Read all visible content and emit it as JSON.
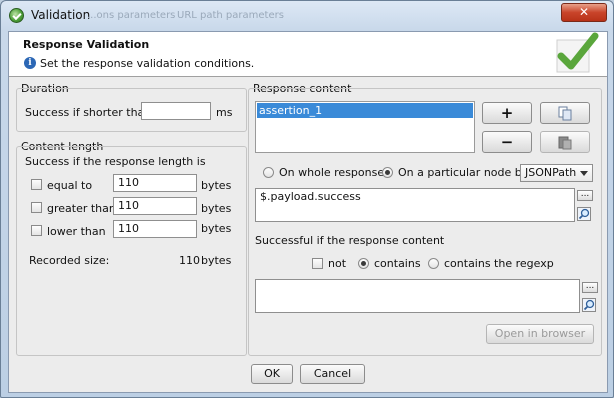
{
  "window": {
    "title": "Validation",
    "ghost_tab_1": "...ons parameters",
    "ghost_tab_2": "URL path parameters",
    "close_glyph": "✕"
  },
  "header": {
    "title": "Response Validation",
    "subtitle": "Set the response validation conditions."
  },
  "duration": {
    "label": "Duration",
    "shorter_label": "Success if shorter than",
    "value": "",
    "unit": "ms"
  },
  "content_length": {
    "label": "Content length",
    "intro": "Success if the response length is",
    "rows": [
      {
        "label": "equal to",
        "value": "110",
        "unit": "bytes",
        "checked": false
      },
      {
        "label": "greater than",
        "value": "110",
        "unit": "bytes",
        "checked": false
      },
      {
        "label": "lower than",
        "value": "110",
        "unit": "bytes",
        "checked": false
      }
    ],
    "recorded_label": "Recorded size:",
    "recorded_value": "110",
    "recorded_unit": "bytes"
  },
  "response_content": {
    "label": "Response content",
    "assertions": [
      "assertion_1"
    ],
    "add_label": "+",
    "remove_label": "−",
    "scope_whole": "On whole response",
    "scope_node": "On a particular node by",
    "selector": "JSONPath",
    "path_value": "$.payload.success",
    "success_label": "Successful if the response content",
    "not_label": "not",
    "contains_label": "contains",
    "regex_label": "contains the regexp",
    "content_value": "",
    "open_browser_label": "Open in browser",
    "ellipsis": "..."
  },
  "footer": {
    "ok_label": "OK",
    "cancel_label": "Cancel"
  },
  "icons": [
    "app-logo-icon",
    "info-icon",
    "big-checkmark-icon",
    "copy-icon",
    "paste-icon",
    "magnifier-icon",
    "chevron-down-icon"
  ]
}
